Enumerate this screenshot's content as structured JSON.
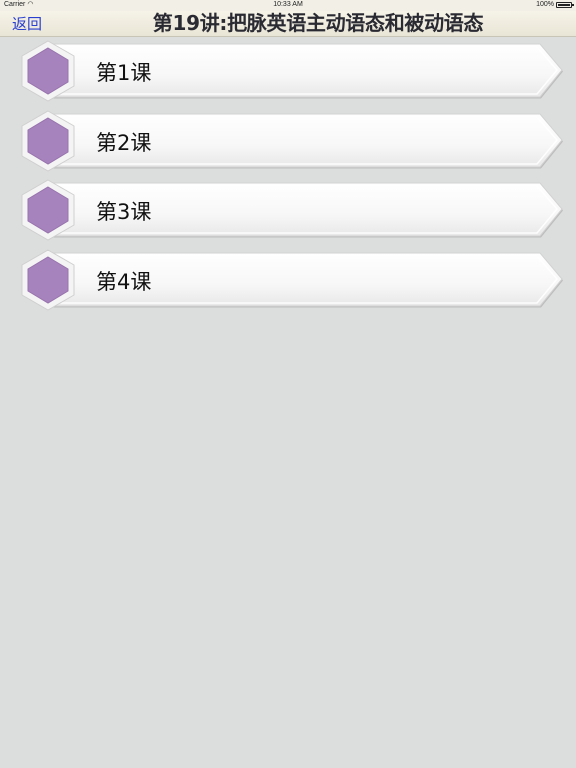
{
  "status_bar": {
    "carrier": "Carrier",
    "wifi_icon": "wifi-icon",
    "time": "10:33 AM",
    "battery": "100%"
  },
  "nav": {
    "back_label": "返回",
    "title": "第19讲:把脉英语主动语态和被动语态"
  },
  "lessons": [
    {
      "label": "第1课",
      "icon": "hexagon-icon"
    },
    {
      "label": "第2课",
      "icon": "hexagon-icon"
    },
    {
      "label": "第3课",
      "icon": "hexagon-icon"
    },
    {
      "label": "第4课",
      "icon": "hexagon-icon"
    }
  ],
  "colors": {
    "background": "#dcdedd",
    "hex_fill": "#a783bd",
    "back_link": "#2a3fd0"
  }
}
